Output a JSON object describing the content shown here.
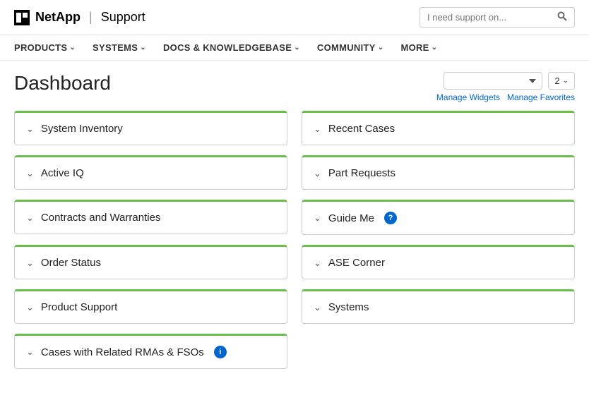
{
  "header": {
    "logo_netapp": "NetApp",
    "logo_divider": "|",
    "logo_support": "Support",
    "search_placeholder": "I need support on..."
  },
  "nav": {
    "items": [
      {
        "label": "PRODUCTS",
        "id": "products"
      },
      {
        "label": "SYSTEMS",
        "id": "systems"
      },
      {
        "label": "DOCS & KNOWLEDGEBASE",
        "id": "docs"
      },
      {
        "label": "COMMUNITY",
        "id": "community"
      },
      {
        "label": "MORE",
        "id": "more"
      }
    ]
  },
  "dashboard": {
    "title": "Dashboard",
    "widget_count": "2",
    "manage_widgets": "Manage Widgets",
    "manage_favorites": "Manage Favorites"
  },
  "left_widgets": [
    {
      "label": "System Inventory",
      "id": "system-inventory",
      "has_info": false,
      "has_question": false
    },
    {
      "label": "Active IQ",
      "id": "active-iq",
      "has_info": false,
      "has_question": false
    },
    {
      "label": "Contracts and Warranties",
      "id": "contracts-warranties",
      "has_info": false,
      "has_question": false
    },
    {
      "label": "Order Status",
      "id": "order-status",
      "has_info": false,
      "has_question": false
    },
    {
      "label": "Product Support",
      "id": "product-support",
      "has_info": false,
      "has_question": false
    },
    {
      "label": "Cases with Related RMAs & FSOs",
      "id": "cases-rmas-fsos",
      "has_info": true,
      "has_question": false
    }
  ],
  "right_widgets": [
    {
      "label": "Recent Cases",
      "id": "recent-cases",
      "has_info": false,
      "has_question": false
    },
    {
      "label": "Part Requests",
      "id": "part-requests",
      "has_info": false,
      "has_question": false
    },
    {
      "label": "Guide Me",
      "id": "guide-me",
      "has_info": false,
      "has_question": true
    },
    {
      "label": "ASE Corner",
      "id": "ase-corner",
      "has_info": false,
      "has_question": false
    },
    {
      "label": "Systems",
      "id": "systems-widget",
      "has_info": false,
      "has_question": false
    }
  ],
  "icons": {
    "chevron_down": "∨",
    "info": "i",
    "question": "?"
  }
}
